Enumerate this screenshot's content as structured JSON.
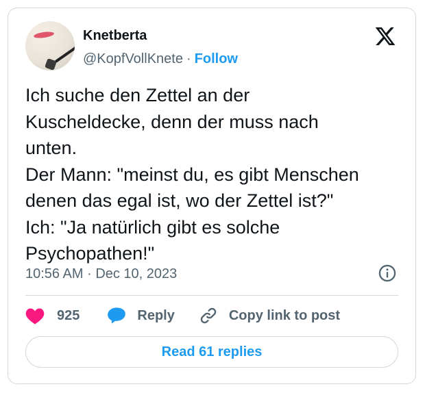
{
  "author": {
    "name": "Knetberta",
    "handle": "@KopfVollKnete",
    "separator": "·",
    "follow_label": "Follow"
  },
  "tweet": {
    "text": "Ich suche den Zettel an der\nKuscheldecke, denn der muss nach\nunten.\nDer Mann: \"meinst du, es gibt Menschen\ndenen das egal ist, wo der Zettel ist?\"\nIch: \"Ja natürlich gibt es solche\nPsychopathen!\"",
    "time": "10:56 AM",
    "separator": "·",
    "date": "Dec 10, 2023"
  },
  "actions": {
    "likes": "925",
    "reply_label": "Reply",
    "copy_link_label": "Copy link to post"
  },
  "read_replies_label": "Read 61 replies",
  "colors": {
    "like": "#f91880",
    "reply": "#1d9bf0",
    "link": "#1d9bf0",
    "text": "#0f1419",
    "muted": "#536471",
    "border": "#cfd9de"
  },
  "icons": [
    "x-logo-icon",
    "info-icon",
    "heart-icon",
    "reply-bubble-icon",
    "link-icon"
  ]
}
